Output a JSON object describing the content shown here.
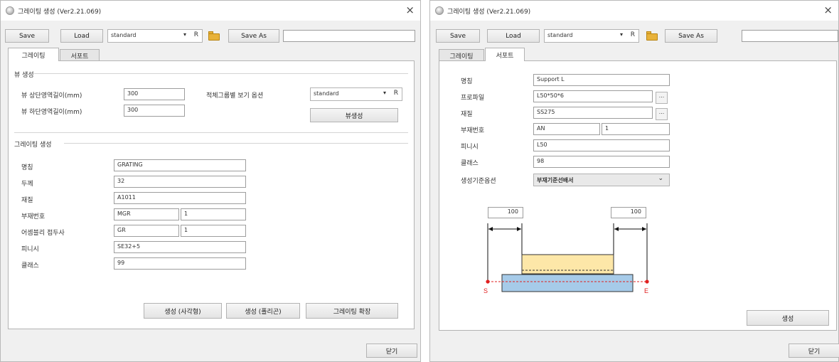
{
  "window": {
    "title": "그레이팅 생성 (Ver2.21.069)",
    "close_glyph": "×",
    "close_label": "닫기"
  },
  "toolbar": {
    "save_label": "Save",
    "load_label": "Load",
    "preset_value": "standard",
    "preset_arrow": "▾",
    "preset_suffix": "R",
    "save_as_label": "Save As",
    "save_as_name": ""
  },
  "tabs": {
    "grating": "그레이팅",
    "support": "서포트"
  },
  "grating_tab": {
    "view_group_title": "뷰 생성",
    "top_area_label": "뷰 상단영역길이(mm)",
    "top_area_value": "300",
    "bottom_area_label": "뷰 하단영역길이(mm)",
    "bottom_area_value": "300",
    "view_option_label": "적체그룹별 보기 옵션",
    "view_option_value": "standard",
    "view_option_arrow": "▾",
    "view_option_suffix": "R",
    "view_create_button": "뷰생성",
    "create_group_title": "그레이팅 생성",
    "fields": [
      {
        "label": "명칭",
        "value": "GRATING",
        "value2": null
      },
      {
        "label": "두께",
        "value": "32",
        "value2": null
      },
      {
        "label": "재질",
        "value": "A1011",
        "value2": null
      },
      {
        "label": "부재번호",
        "value": "MGR",
        "value2": "1"
      },
      {
        "label": "어셈블리 접두사",
        "value": "GR",
        "value2": "1"
      },
      {
        "label": "피니시",
        "value": "SE32+5",
        "value2": null
      },
      {
        "label": "클래스",
        "value": "99",
        "value2": null
      }
    ],
    "buttons": {
      "rect": "생성 (사각형)",
      "poly": "생성 (폴리곤)",
      "extend": "그레이팅 확장"
    }
  },
  "support_tab": {
    "fields": [
      {
        "label": "명칭",
        "value": "Support L",
        "value2": null,
        "ellipsis": false
      },
      {
        "label": "프로파일",
        "value": "L50*50*6",
        "value2": null,
        "ellipsis": true
      },
      {
        "label": "재질",
        "value": "SS275",
        "value2": null,
        "ellipsis": true
      },
      {
        "label": "부재번호",
        "value": "AN",
        "value2": "1",
        "ellipsis": false
      },
      {
        "label": "피니시",
        "value": "L50",
        "value2": null,
        "ellipsis": false
      },
      {
        "label": "클래스",
        "value": "98",
        "value2": null,
        "ellipsis": false
      }
    ],
    "ellipsis_glyph": "...",
    "basis_label": "생성기준옵션",
    "basis_value": "부재기준선배서",
    "basis_arrow": "⌄",
    "offset_left": "100",
    "offset_right": "100",
    "start_marker": "S",
    "end_marker": "E",
    "create_button": "생성",
    "colors": {
      "grating_fill": "#fde7a8",
      "support_fill": "#a6cbe9",
      "marker_red": "#e02020"
    }
  }
}
